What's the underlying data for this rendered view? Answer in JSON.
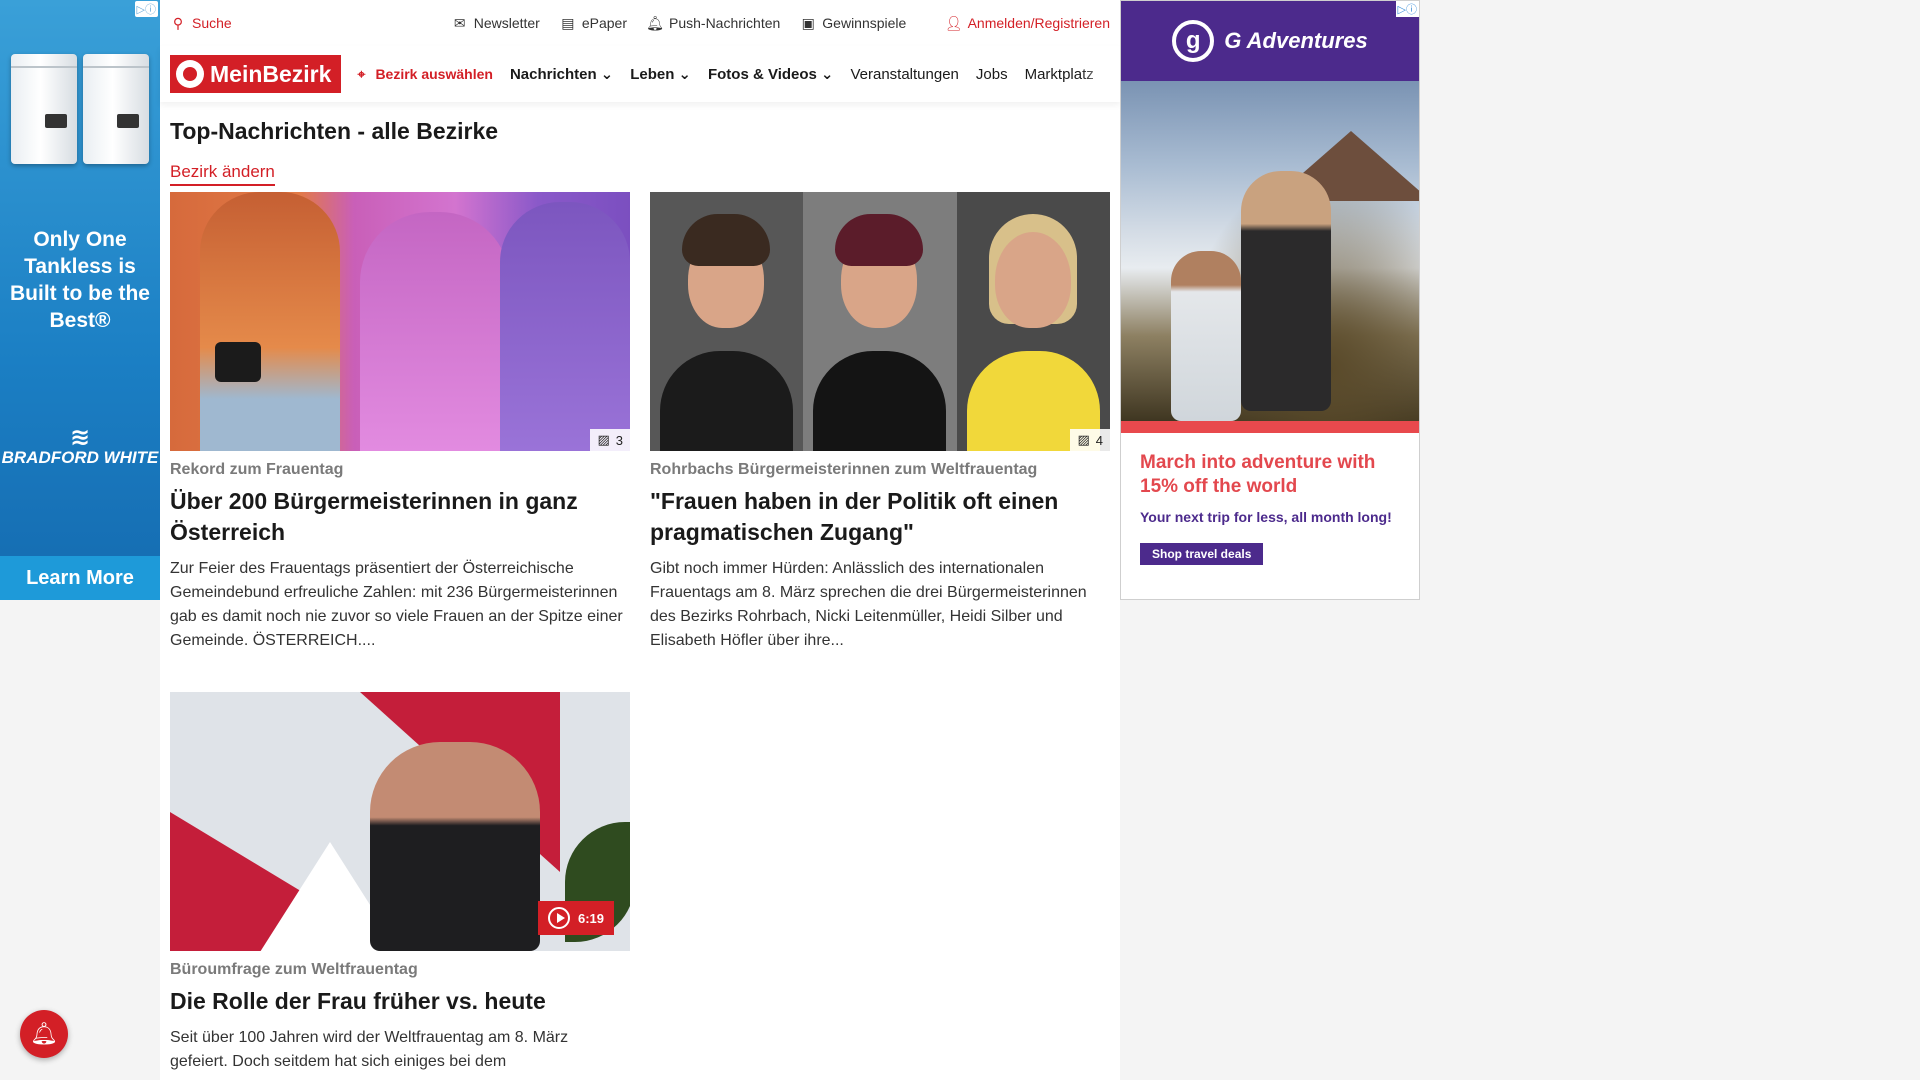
{
  "ads": {
    "left": {
      "choice": "▷ⓘ",
      "tagline": "Only One Tankless is Built to be the Best®",
      "brand": "BRADFORD WHITE",
      "cta": "Learn More",
      "accent": "#1e9ad9"
    },
    "right": {
      "choice": "▷ⓘ",
      "brand": "G Adventures",
      "headline": "March into adventure with 15% off the world",
      "sub": "Your next trip for less, all month long!",
      "cta": "Shop travel deals",
      "accent": "#4c2a8c"
    }
  },
  "topbar": {
    "search": "Suche",
    "newsletter": "Newsletter",
    "epaper": "ePaper",
    "push": "Push-Nachrichten",
    "gewinnspiele": "Gewinnspiele",
    "login": "Anmelden/Registrieren"
  },
  "nav": {
    "logo": "MeinBezirk",
    "bezirk": "Bezirk auswählen",
    "items": [
      "Nachrichten",
      "Leben",
      "Fotos & Videos",
      "Veranstaltungen",
      "Jobs",
      "Marktplatz"
    ]
  },
  "page": {
    "title": "Top-Nachrichten - alle Bezirke",
    "change": "Bezirk ändern"
  },
  "articles": [
    {
      "kicker": "Rekord zum Frauentag",
      "headline": "Über 200 Bürgermeisterinnen in ganz Österreich",
      "teaser": "Zur Feier des Frauentags präsentiert der Österreichische Gemeindebund erfreuliche Zahlen: mit 236 Bürgermeisterinnen gab es damit noch nie zuvor so viele Frauen an der Spitze einer Gemeinde. ÖSTERREICH....",
      "photos": "3"
    },
    {
      "kicker": "Rohrbachs Bürgermeisterinnen zum Weltfrauentag",
      "headline": "\"Frauen haben in der Politik oft einen pragmatischen Zugang\"",
      "teaser": "Gibt noch immer Hürden: Anlässlich des internationalen Frauentags am 8. März sprechen die drei Bürgermeisterinnen des Bezirks Rohrbach, Nicki Leitenmüller, Heidi Silber und Elisabeth Höfler über ihre...",
      "photos": "4"
    },
    {
      "kicker": "Büroumfrage zum Weltfrauentag",
      "headline": "Die Rolle der Frau früher vs. heute",
      "teaser": "Seit über 100 Jahren wird der Weltfrauentag am 8. März gefeiert. Doch seitdem hat sich einiges bei dem",
      "duration": "6:19"
    }
  ],
  "colors": {
    "brand": "#d31f26"
  }
}
